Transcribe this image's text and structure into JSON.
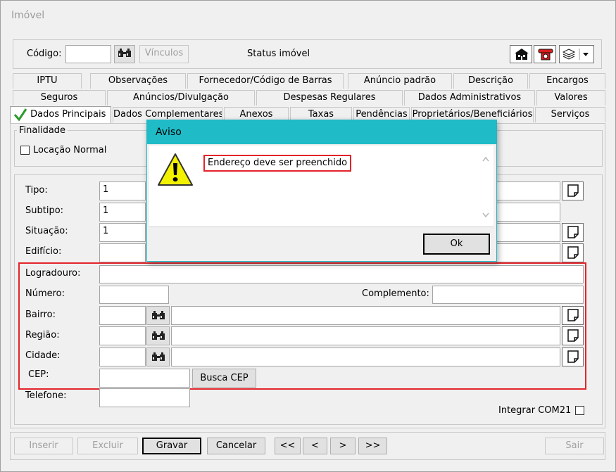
{
  "window": {
    "title": "Imóvel"
  },
  "header": {
    "codigo_label": "Código:",
    "codigo_value": "",
    "vinculos_label": "Vínculos",
    "status_label": "Status imóvel"
  },
  "tabs": {
    "row1": [
      "IPTU",
      "Observações",
      "Fornecedor/Código de Barras",
      "Anúncio padrão",
      "Descrição",
      "Encargos"
    ],
    "row2": [
      "Seguros",
      "Anúncios/Divulgação",
      "Despesas Regulares",
      "Dados Administrativos",
      "Valores"
    ],
    "row3": [
      "Dados Principais",
      "Dados Complementares",
      "Anexos",
      "Taxas",
      "Pendências",
      "Proprietários/Beneficiários",
      "Serviços"
    ]
  },
  "finalidade": {
    "title": "Finalidade",
    "locacao_normal": "Locação Normal",
    "locacao_normal_checked": false
  },
  "form": {
    "tipo_label": "Tipo:",
    "tipo_value": "1",
    "subtipo_label": "Subtipo:",
    "subtipo_value": "1",
    "situacao_label": "Situação:",
    "situacao_value": "1",
    "edificio_label": "Edifício:",
    "logradouro_label": "Logradouro:",
    "numero_label": "Número:",
    "complemento_label": "Complemento:",
    "bairro_label": "Bairro:",
    "regiao_label": "Região:",
    "cidade_label": "Cidade:",
    "cep_label": "CEP:",
    "busca_cep_label": "Busca CEP",
    "telefone_label": "Telefone:",
    "integrar_label": "Integrar COM21",
    "integrar_checked": false
  },
  "footer": {
    "inserir": "Inserir",
    "excluir": "Excluir",
    "gravar": "Gravar",
    "cancelar": "Cancelar",
    "first": "<<",
    "prev": "<",
    "next": ">",
    "last": ">>",
    "sair": "Sair"
  },
  "dialog": {
    "title": "Aviso",
    "message": "Endereço deve ser preenchido",
    "ok_label": "Ok"
  },
  "colors": {
    "dialog_title_bg": "#1fbcc8",
    "highlight_red": "#e3242b",
    "checkmark_green": "#2a9a2a"
  },
  "icons": [
    "binoculars-icon",
    "house-icon",
    "telephone-icon",
    "layers-icon",
    "document-icon",
    "warning-icon",
    "checkmark-icon"
  ]
}
